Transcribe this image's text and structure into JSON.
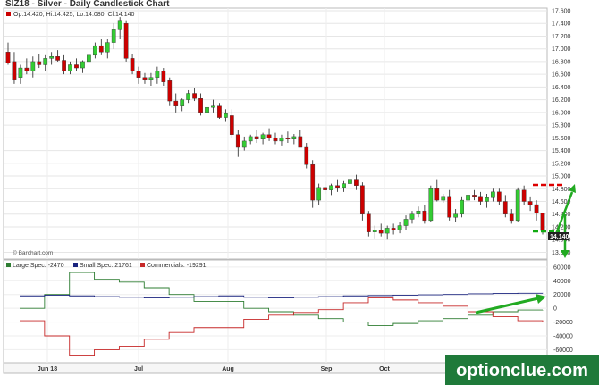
{
  "header": {
    "title": "SIZ18 - Silver - Daily Candlestick Chart",
    "ohlc_text": "Op:14.420, Hi:14.425, Lo:14.080, Cl:14.140",
    "credit": "© Barchart.com",
    "last_price": "14.140"
  },
  "cot_legend": [
    {
      "label": "Large Spec: -2470",
      "color": "#2e7d32"
    },
    {
      "label": "Small Spec: 21761",
      "color": "#1a237e"
    },
    {
      "label": "Commercials: -19291",
      "color": "#c62828"
    }
  ],
  "watermark": "optionclue.com",
  "colors": {
    "up": "#33cc33",
    "down": "#cc0000",
    "wick": "#222222",
    "large_spec": "#2e7d32",
    "small_spec": "#1a237e",
    "commercials": "#c62828",
    "annotation_arrow": "#22aa22",
    "annotation_red": "#dd0000",
    "annotation_green": "#11aa11",
    "watermark_bg": "#1f7a3a"
  },
  "chart_data": [
    {
      "type": "candlestick",
      "title": "SIZ18 - Silver - Daily Candlestick Chart",
      "x_labels": [
        "Jun 18",
        "Jul",
        "Aug",
        "Sep",
        "Oct"
      ],
      "y_ticks": [
        "17.600",
        "17.400",
        "17.200",
        "17.000",
        "16.800",
        "16.600",
        "16.400",
        "16.200",
        "16.000",
        "15.800",
        "15.600",
        "15.400",
        "15.200",
        "15.000",
        "14.800",
        "14.600",
        "14.400",
        "14.200",
        "14.000",
        "13.800"
      ],
      "ylim": [
        13.75,
        17.6
      ],
      "candles": [
        [
          16.95,
          17.1,
          16.75,
          16.78
        ],
        [
          16.8,
          16.95,
          16.45,
          16.52
        ],
        [
          16.55,
          16.75,
          16.45,
          16.7
        ],
        [
          16.7,
          16.85,
          16.6,
          16.65
        ],
        [
          16.65,
          16.88,
          16.55,
          16.8
        ],
        [
          16.8,
          16.92,
          16.7,
          16.75
        ],
        [
          16.75,
          16.9,
          16.65,
          16.85
        ],
        [
          16.85,
          16.95,
          16.75,
          16.88
        ],
        [
          16.88,
          16.98,
          16.8,
          16.82
        ],
        [
          16.82,
          16.9,
          16.6,
          16.65
        ],
        [
          16.65,
          16.8,
          16.6,
          16.75
        ],
        [
          16.75,
          16.85,
          16.65,
          16.7
        ],
        [
          16.7,
          16.82,
          16.62,
          16.8
        ],
        [
          16.8,
          16.95,
          16.72,
          16.9
        ],
        [
          16.9,
          17.1,
          16.85,
          17.05
        ],
        [
          17.05,
          17.15,
          16.9,
          16.95
        ],
        [
          16.95,
          17.15,
          16.85,
          17.1
        ],
        [
          17.1,
          17.4,
          17.0,
          17.3
        ],
        [
          17.3,
          17.5,
          17.15,
          17.45
        ],
        [
          17.4,
          17.45,
          16.8,
          16.85
        ],
        [
          16.85,
          16.92,
          16.6,
          16.65
        ],
        [
          16.65,
          16.72,
          16.45,
          16.55
        ],
        [
          16.55,
          16.62,
          16.45,
          16.52
        ],
        [
          16.52,
          16.62,
          16.42,
          16.55
        ],
        [
          16.55,
          16.72,
          16.45,
          16.65
        ],
        [
          16.65,
          16.7,
          16.42,
          16.48
        ],
        [
          16.5,
          16.55,
          16.1,
          16.18
        ],
        [
          16.18,
          16.3,
          16.0,
          16.1
        ],
        [
          16.1,
          16.22,
          16.02,
          16.2
        ],
        [
          16.2,
          16.35,
          16.15,
          16.3
        ],
        [
          16.3,
          16.38,
          16.18,
          16.22
        ],
        [
          16.22,
          16.3,
          15.95,
          16.0
        ],
        [
          16.0,
          16.1,
          15.88,
          16.08
        ],
        [
          16.08,
          16.2,
          16.0,
          16.1
        ],
        [
          16.1,
          16.15,
          15.9,
          15.92
        ],
        [
          15.92,
          16.05,
          15.85,
          15.98
        ],
        [
          15.95,
          16.05,
          15.6,
          15.65
        ],
        [
          15.65,
          15.72,
          15.3,
          15.45
        ],
        [
          15.45,
          15.62,
          15.4,
          15.55
        ],
        [
          15.55,
          15.65,
          15.5,
          15.62
        ],
        [
          15.62,
          15.72,
          15.52,
          15.58
        ],
        [
          15.58,
          15.68,
          15.5,
          15.65
        ],
        [
          15.65,
          15.75,
          15.55,
          15.6
        ],
        [
          15.6,
          15.68,
          15.5,
          15.55
        ],
        [
          15.55,
          15.65,
          15.48,
          15.6
        ],
        [
          15.6,
          15.7,
          15.52,
          15.58
        ],
        [
          15.58,
          15.66,
          15.5,
          15.62
        ],
        [
          15.62,
          15.72,
          15.55,
          15.45
        ],
        [
          15.45,
          15.52,
          15.12,
          15.18
        ],
        [
          15.18,
          15.25,
          14.5,
          14.62
        ],
        [
          14.62,
          14.88,
          14.55,
          14.82
        ],
        [
          14.82,
          14.92,
          14.72,
          14.78
        ],
        [
          14.78,
          14.88,
          14.7,
          14.85
        ],
        [
          14.85,
          14.95,
          14.75,
          14.82
        ],
        [
          14.82,
          14.92,
          14.75,
          14.88
        ],
        [
          14.88,
          15.05,
          14.82,
          14.95
        ],
        [
          14.95,
          15.02,
          14.78,
          14.85
        ],
        [
          14.85,
          14.9,
          14.3,
          14.4
        ],
        [
          14.4,
          14.45,
          14.05,
          14.12
        ],
        [
          14.12,
          14.22,
          14.02,
          14.15
        ],
        [
          14.15,
          14.25,
          14.05,
          14.1
        ],
        [
          14.1,
          14.22,
          14.0,
          14.18
        ],
        [
          14.18,
          14.25,
          14.08,
          14.15
        ],
        [
          14.15,
          14.28,
          14.1,
          14.22
        ],
        [
          14.22,
          14.38,
          14.15,
          14.32
        ],
        [
          14.32,
          14.45,
          14.25,
          14.4
        ],
        [
          14.4,
          14.52,
          14.35,
          14.45
        ],
        [
          14.45,
          14.55,
          14.25,
          14.3
        ],
        [
          14.3,
          14.85,
          14.28,
          14.8
        ],
        [
          14.8,
          14.95,
          14.6,
          14.62
        ],
        [
          14.62,
          14.72,
          14.58,
          14.68
        ],
        [
          14.68,
          14.78,
          14.3,
          14.35
        ],
        [
          14.35,
          14.48,
          14.28,
          14.4
        ],
        [
          14.4,
          14.68,
          14.35,
          14.62
        ],
        [
          14.62,
          14.75,
          14.55,
          14.7
        ],
        [
          14.7,
          14.78,
          14.62,
          14.68
        ],
        [
          14.68,
          14.75,
          14.55,
          14.6
        ],
        [
          14.6,
          14.72,
          14.5,
          14.66
        ],
        [
          14.66,
          14.8,
          14.6,
          14.75
        ],
        [
          14.75,
          14.8,
          14.55,
          14.6
        ],
        [
          14.6,
          14.7,
          14.35,
          14.4
        ],
        [
          14.4,
          14.48,
          14.25,
          14.3
        ],
        [
          14.3,
          14.82,
          14.28,
          14.78
        ],
        [
          14.78,
          14.85,
          14.55,
          14.6
        ],
        [
          14.6,
          14.68,
          14.45,
          14.55
        ],
        [
          14.55,
          14.62,
          14.3,
          14.42
        ],
        [
          14.42,
          14.425,
          14.08,
          14.14
        ]
      ]
    },
    {
      "type": "line",
      "title": "",
      "y_ticks": [
        "60000",
        "40000",
        "20000",
        "0",
        "-20000",
        "-40000",
        "-60000"
      ],
      "ylim": [
        -75000,
        65000
      ],
      "series": [
        {
          "name": "Large Spec: -2470",
          "color": "#2e7d32",
          "values": [
            0,
            20000,
            52000,
            42000,
            38000,
            30000,
            20000,
            10000,
            10000,
            0,
            -5000,
            -10000,
            -15000,
            -20000,
            -25000,
            -22000,
            -18000,
            -15000,
            -10000,
            -5000,
            -2500,
            -2470
          ]
        },
        {
          "name": "Small Spec: 21761",
          "color": "#1a237e",
          "values": [
            18000,
            19000,
            18000,
            17000,
            16000,
            15000,
            16000,
            17000,
            18000,
            16000,
            15000,
            16000,
            17000,
            18000,
            18500,
            19000,
            19500,
            20000,
            21000,
            21500,
            21800,
            21761
          ]
        },
        {
          "name": "Commercials: -19291",
          "color": "#c62828",
          "values": [
            -18000,
            -40000,
            -68000,
            -60000,
            -55000,
            -45000,
            -35000,
            -28000,
            -28000,
            -16000,
            -10000,
            -6000,
            -2000,
            8000,
            15000,
            12000,
            8000,
            3000,
            -5000,
            -12000,
            -18000,
            -19291
          ]
        }
      ]
    }
  ]
}
